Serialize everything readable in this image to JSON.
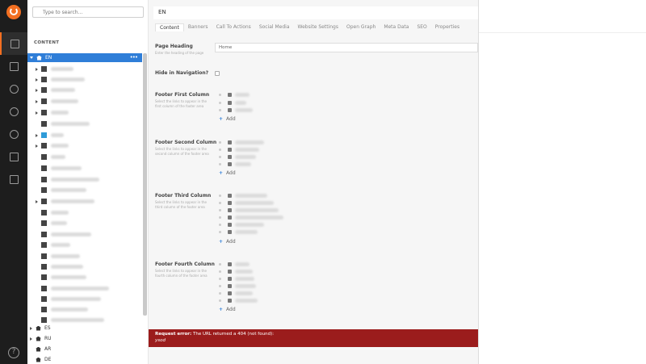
{
  "search": {
    "placeholder": "Type to search..."
  },
  "tree": {
    "section_label": "CONTENT",
    "root": {
      "label": "EN"
    },
    "more_label": "•••",
    "other_roots": [
      {
        "label": "ES"
      },
      {
        "label": "RU"
      },
      {
        "label": "AR"
      },
      {
        "label": "DE"
      }
    ]
  },
  "content": {
    "name_value": "EN",
    "tabs": [
      "Content",
      "Banners",
      "Call To Actions",
      "Social Media",
      "Website Settings",
      "Open Graph",
      "Meta Data",
      "SEO",
      "Properties"
    ],
    "fields": {
      "page_heading": {
        "title": "Page Heading",
        "desc": "Enter the heading of the page",
        "value": "Home"
      },
      "hide_nav": {
        "title": "Hide in Navigation?"
      },
      "footer1": {
        "title": "Footer First Column",
        "desc": "Select the links to appear in the first column of the footer area"
      },
      "footer2": {
        "title": "Footer Second Column",
        "desc": "Select the links to appear in the second column of the footer area"
      },
      "footer3": {
        "title": "Footer Third Column",
        "desc": "Select the links to appear in the third column of the footer area"
      },
      "footer4": {
        "title": "Footer Fourth Column",
        "desc": "Select the links to appear in the fourth column of the footer area"
      }
    },
    "add_label": "Add"
  },
  "error": {
    "title_bold": "Request error:",
    "title_rest": " The URL returned a 404 (not found):",
    "detail": "ysod"
  },
  "colors": {
    "accent": "#2f7ed8",
    "brand": "#f36f21",
    "error": "#9b1c1c",
    "nav": "#1d1d1d"
  },
  "nav_icons": [
    "content-icon",
    "media-icon",
    "settings-tools-icon",
    "gear-icon",
    "user-icon",
    "members-icon",
    "forms-icon",
    "help-icon"
  ]
}
